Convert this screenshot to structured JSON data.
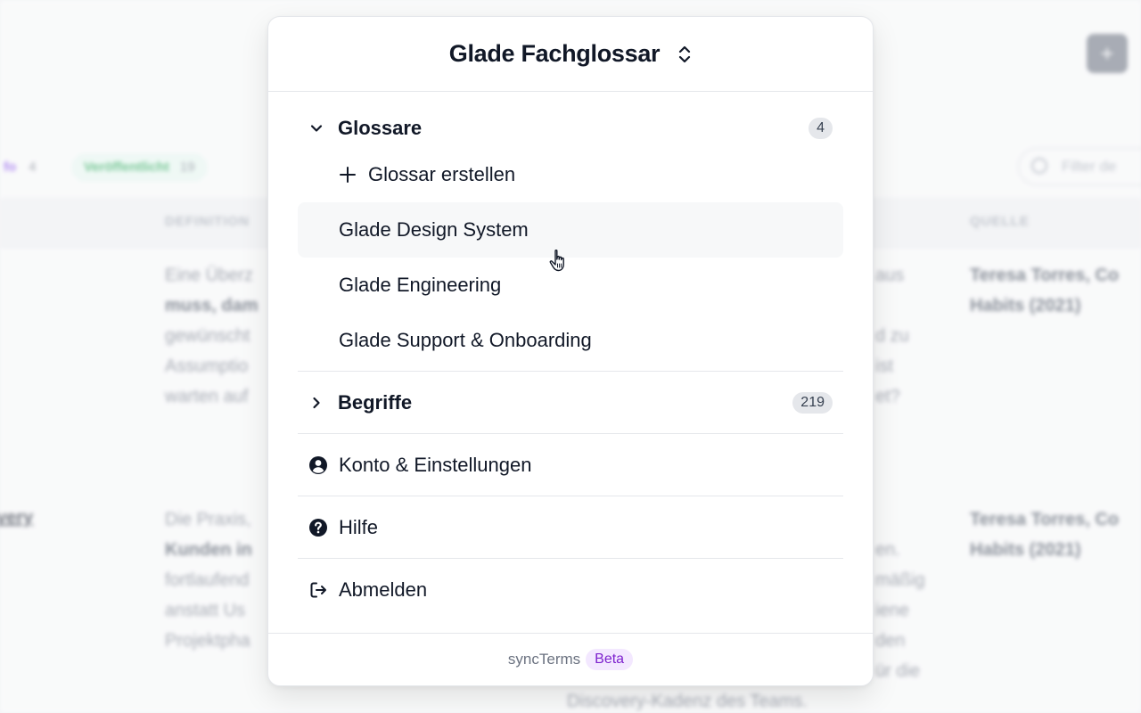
{
  "background": {
    "add_button": "+",
    "filters": [
      {
        "label": "fo",
        "count": "4"
      },
      {
        "label": "Veröffentlicht",
        "count": "19"
      }
    ],
    "search_placeholder": "Filter de",
    "columns": [
      "DEFINITION",
      "QUELLE"
    ],
    "rows": [
      {
        "term": "",
        "definition_lines": [
          "Eine Überz",
          "muss, dam",
          "gewünscht",
          "Assumptio",
          "warten auf"
        ],
        "extra_lines": [
          "aus",
          "d zu",
          "ist",
          "et?"
        ],
        "source_lines": [
          "Teresa Torres, Co",
          "Habits (2021)"
        ]
      },
      {
        "term": "very",
        "definition_lines": [
          "Die Praxis,",
          "Kunden in",
          "fortlaufend",
          "anstatt Us",
          "Projektpha"
        ],
        "extra_lines": [
          "en.",
          "mäßig",
          "iene",
          "den",
          "ür die",
          "Discovery-Kadenz des Teams."
        ],
        "source_lines": [
          "Teresa Torres, Co",
          "Habits (2021)"
        ]
      }
    ]
  },
  "popover": {
    "title": "Glade Fachglossar",
    "glossaries": {
      "label": "Glossare",
      "count": "4",
      "create_label": "Glossar erstellen",
      "items": [
        {
          "label": "Glade Design System"
        },
        {
          "label": "Glade Engineering"
        },
        {
          "label": "Glade Support & Onboarding"
        }
      ]
    },
    "terms": {
      "label": "Begriffe",
      "count": "219"
    },
    "menu": {
      "account": "Konto & Einstellungen",
      "help": "Hilfe",
      "logout": "Abmelden"
    },
    "footer": {
      "brand": "syncTerms",
      "badge": "Beta"
    }
  },
  "colors": {
    "accent_purple": "#7e22ce",
    "text": "#111827",
    "muted": "#6b7280"
  }
}
